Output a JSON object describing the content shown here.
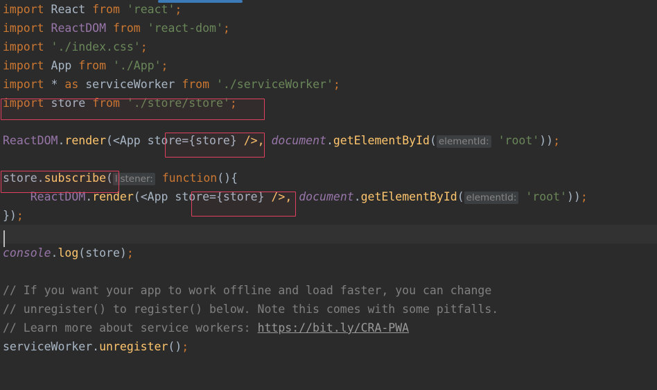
{
  "editor": {
    "background_color": "#2b2b2b",
    "caret_line_color": "#323232",
    "annotation_color": "#e0415f",
    "scrollbar_color": "#3d7ab8"
  },
  "code": {
    "line1": {
      "kw_import": "import",
      "ident_react": " React ",
      "kw_from": "from",
      "str_module": " 'react'",
      "semi": ";"
    },
    "line2": {
      "kw_import": "import",
      "ident_reactdom": " ReactDOM ",
      "kw_from": "from",
      "str_module": " 'react-dom'",
      "semi": ";"
    },
    "line3": {
      "kw_import": "import",
      "str_module": " './index.css'",
      "semi": ";"
    },
    "line4": {
      "kw_import": "import",
      "ident_app": " App ",
      "kw_from": "from",
      "str_module": " './App'",
      "semi": ";"
    },
    "line5": {
      "kw_import": "import",
      "star": " * ",
      "kw_as": "as",
      "ident_sw": " serviceWorker ",
      "kw_from": "from",
      "str_module": " './serviceWorker'",
      "semi": ";"
    },
    "line6": {
      "kw_import": "import",
      "ident_store": " store ",
      "kw_from": "from",
      "str_module": " './store/store'",
      "semi": ";"
    },
    "line8": {
      "obj": "ReactDOM",
      "dot": ".",
      "method": "render",
      "open": "(",
      "jsx_open": "<App ",
      "prop": "store={store}",
      "jsx_close": " />,",
      "doc": " document",
      "dot2": ".",
      "method2": "getElementById",
      "open2": "(",
      "hint": "elementId:",
      "str_root": " 'root'",
      "close": "))",
      "semi": ";"
    },
    "line10": {
      "obj": "store",
      "dot": ".",
      "method": "subscribe",
      "open": "(",
      "hint": "listener:",
      "kw_function": " function",
      "parens": "(){"
    },
    "line11": {
      "indent": "    ",
      "obj": "ReactDOM",
      "dot": ".",
      "method": "render",
      "open": "(",
      "jsx_open": "<App ",
      "prop": "store={store}",
      "jsx_close": " />,",
      "doc": " document",
      "dot2": ".",
      "method2": "getElementById",
      "open2": "(",
      "hint": "elementId:",
      "str_root": " 'root'",
      "close": "))",
      "semi": ";"
    },
    "line12": {
      "close": "})",
      "semi": ";"
    },
    "line13": {
      "empty": ""
    },
    "line14": {
      "obj": "console",
      "dot": ".",
      "method": "log",
      "open": "(",
      "arg": "store",
      "close": ")",
      "semi": ";"
    },
    "line16": {
      "comment": "// If you want your app to work offline and load faster, you can change"
    },
    "line17": {
      "comment": "// unregister() to register() below. Note this comes with some pitfalls."
    },
    "line18": {
      "comment_prefix": "// Learn more about service workers: ",
      "link": "https://bit.ly/CRA-PWA"
    },
    "line19": {
      "obj": "serviceWorker",
      "dot": ".",
      "method": "unregister",
      "parens": "()",
      "semi": ";"
    }
  },
  "annotations": [
    {
      "name": "import-store-highlight",
      "label": "import store from './store/store';"
    },
    {
      "name": "store-prop-highlight-1",
      "label": "store={store}"
    },
    {
      "name": "store-subscribe-highlight",
      "label": "store.subscribe"
    },
    {
      "name": "store-prop-highlight-2",
      "label": "store={store}"
    }
  ]
}
